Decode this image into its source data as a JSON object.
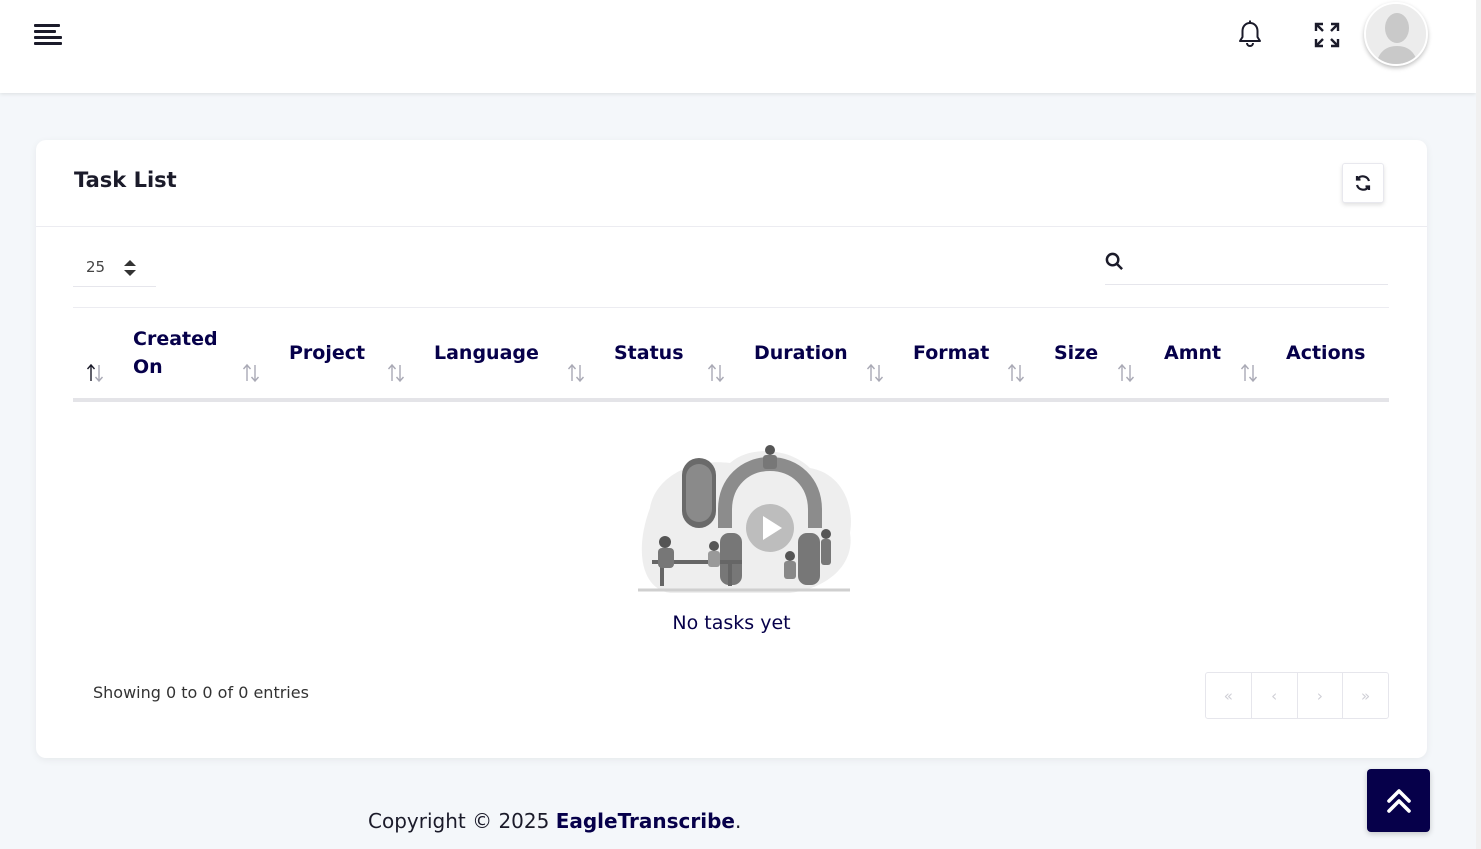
{
  "header": {
    "menu_icon": "hamburger-icon",
    "notification_icon": "bell-icon",
    "fullscreen_icon": "expand-icon",
    "avatar_icon": "user-avatar"
  },
  "card": {
    "title": "Task List",
    "refresh_icon": "refresh-icon"
  },
  "controls": {
    "page_length": "25",
    "search_placeholder": "",
    "search_icon": "search-icon"
  },
  "table": {
    "columns": [
      "Created On",
      "Project",
      "Language",
      "Status",
      "Duration",
      "Format",
      "Size",
      "Amnt",
      "Actions"
    ],
    "rows": []
  },
  "empty_state": {
    "message": "No tasks yet"
  },
  "pagination": {
    "info": "Showing 0 to 0 of 0 entries",
    "buttons": [
      "«",
      "‹",
      "›",
      "»"
    ]
  },
  "footer": {
    "prefix": "Copyright © 2025 ",
    "brand": "EagleTranscribe",
    "suffix": "."
  },
  "colors": {
    "primary": "#06004a",
    "background": "#f4f7fa",
    "card": "#ffffff"
  }
}
